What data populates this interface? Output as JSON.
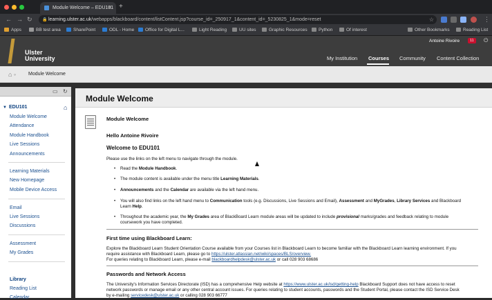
{
  "browser": {
    "tab_title": "Module Welcome – EDU101",
    "url_host": "learning.ulster.ac.uk",
    "url_path": "/webapps/blackboard/content/listContent.jsp?course_id=_250917_1&content_id=_5230825_1&mode=reset",
    "bookmarks": [
      "Apps",
      "BB test area",
      "SharePoint",
      "ODL - Home",
      "Office for Digital L...",
      "Light Reading",
      "UU sites",
      "Graphic Resources",
      "Python",
      "Of interest",
      "Other Bookmarks",
      "Reading List"
    ]
  },
  "header": {
    "logo_text": "Ulster\nUniversity",
    "user_name": "Antoine Rivoire",
    "notif_count": "11",
    "nav": [
      "My Institution",
      "Courses",
      "Community",
      "Content Collection"
    ]
  },
  "breadcrumb": {
    "current": "Module Welcome"
  },
  "sidebar": {
    "course": "EDU101",
    "group1": [
      "Module Welcome",
      "Attendance",
      "Module Handbook",
      "Live Sessions",
      "Announcements"
    ],
    "group2": [
      "Learning Materials",
      "New Homepage",
      "Mobile Device Access"
    ],
    "group3": [
      "Email",
      "Live Sessions",
      "Discussions"
    ],
    "group4": [
      "Assessment",
      "My Grades"
    ],
    "group5_head": "Library",
    "group5": [
      "Reading List",
      "Calendar"
    ]
  },
  "content": {
    "title": "Module Welcome",
    "item_title": "Module Welcome",
    "greeting": "Hello Antoine Rivoire",
    "welcome": "Welcome to EDU101",
    "intro": "Please use the links on the left menu to navigate through the module.",
    "b1a": "Read the ",
    "b1b": "Module Handbook",
    "b1c": ".",
    "b2a": "The module content is available under the menu title ",
    "b2b": "Learning Materials",
    "b2c": ".",
    "b3a": "Announcements",
    "b3b": " and the ",
    "b3c": "Calendar",
    "b3d": " are available via the left hand menu.",
    "b4a": "You will also find links on the left hand menu to ",
    "b4b": "Communication",
    "b4c": " tools (e.g. Discussions, Live Sessions and Email), ",
    "b4d": "Assessment",
    "b4e": " and ",
    "b4f": "MyGrades",
    "b4g": ",  ",
    "b4h": "Library Services",
    "b4i": " and Blackboard",
    "b4j": "Learn ",
    "b4k": "Help",
    "b4l": ".",
    "b5a": "Throughout the academic year, the ",
    "b5b": "My Grades",
    "b5c": " area of BlackBoard Learn module areas will be updated to include ",
    "b5d": "provisional",
    "b5e": " marks/grades and feedback relating to module",
    "b5f": "coursework you have completed.",
    "s1": "First time using Blackboard Learn:",
    "s1p1": "Explore the Blackboard Learn Student Orientation Course available from your Courses list in Blackboard Learn to become familiar with the Blackboard Learn learning environment. If you",
    "s1p2a": "require assistance with Blackboard Learn, please go to ",
    "s1p2b": "https://ulster.atlassian.net/wiki/spaces/BLS/overview.",
    "s1p3a": "For queries relating to Blackboard Learn, please e-mail ",
    "s1p3b": "blackboardhelpdesk@ulster.ac.uk",
    "s1p3c": " or call 028 903 68686",
    "s2": "Passwords and Network Access",
    "s2p1a": "The University's Information Services Directorate (ISD) has a comprehensive Help website at ",
    "s2p1b": "https://www.ulster.ac.uk/isd/getting-help",
    "s2p1c": " Blackboard Support does not have access to reset",
    "s2p2": "network passwords or manage email or any other central account issues. For queries relating to student accounts, passwords and the Student Portal, please contact the ISD Service Desk",
    "s2p3a": "by e-mailing ",
    "s2p3b": "servicedesk@ulster.ac.uk",
    "s2p3c": " or calling 028 903 66777"
  }
}
